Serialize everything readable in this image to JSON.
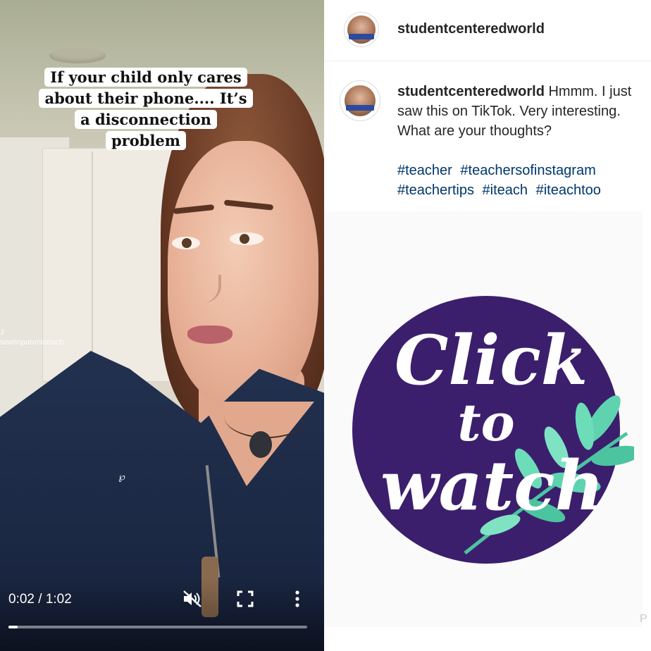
{
  "video": {
    "caption_lines": [
      "If your child only cares",
      "about their phone.... It’s",
      "a disconnection",
      "problem"
    ],
    "handle": "seerinparentcoach",
    "time": "0:02 / 1:02",
    "progress": 0.03,
    "icons": {
      "mute": "volume-muted-icon",
      "fullscreen": "fullscreen-icon",
      "more": "more-vertical-icon"
    }
  },
  "post": {
    "header_username": "studentcenteredworld",
    "caption_username": "studentcenteredworld",
    "caption_text": " Hmmm. I just saw this on TikTok. Very interesting. What are your thoughts?",
    "hashtags": [
      "#teacher",
      "#teachersofinstagram",
      "#teachertips",
      "#iteach",
      "#iteachtoo"
    ]
  },
  "promo": {
    "line1": "Click",
    "line2": "to",
    "line3": "watch",
    "corner_mark": "P"
  },
  "colors": {
    "promo_circle": "#3b1f6d",
    "hashtag": "#00376b",
    "leaf": "#5fd3b0"
  }
}
